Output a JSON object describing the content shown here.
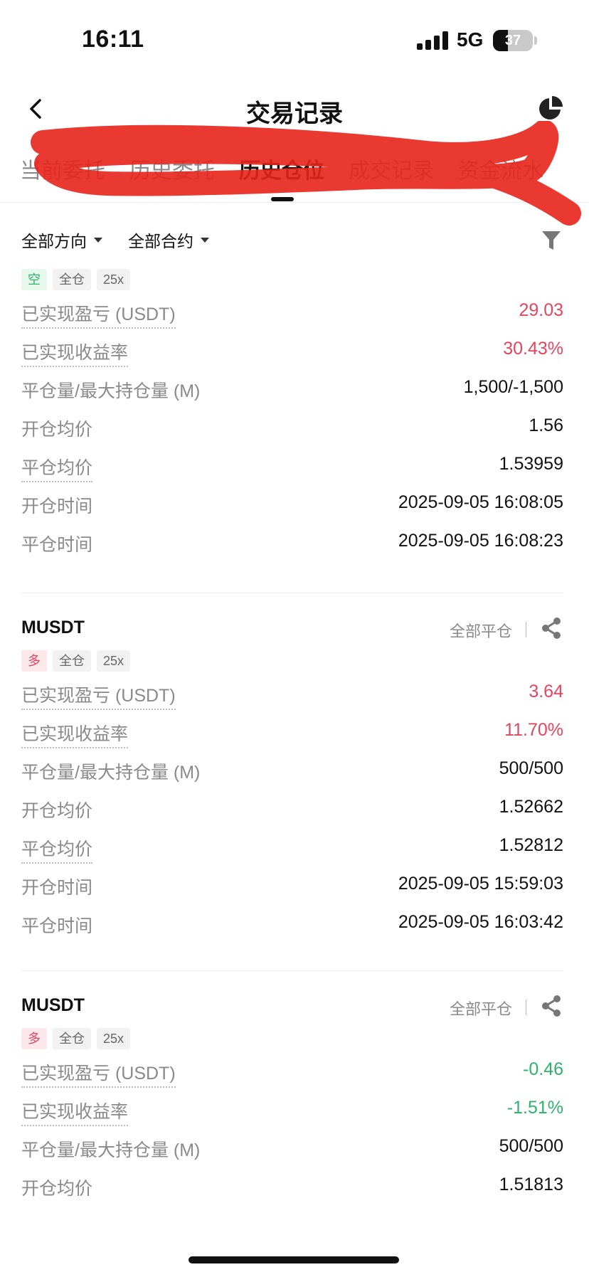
{
  "status": {
    "time": "16:11",
    "network": "5G",
    "battery": "37",
    "battery_level": 0.37
  },
  "header": {
    "title": "交易记录",
    "back_icon": "chevron-left-icon",
    "right_icon": "pie-chart-icon"
  },
  "tabs": [
    {
      "label": "当前委托",
      "active": false
    },
    {
      "label": "历史委托",
      "active": false
    },
    {
      "label": "历史仓位",
      "active": true
    },
    {
      "label": "成交记录",
      "active": false
    },
    {
      "label": "资金流水",
      "active": false
    }
  ],
  "filters": {
    "direction": "全部方向",
    "contract": "全部合约",
    "filter_icon": "funnel-icon"
  },
  "colors": {
    "profit": "#e5455d",
    "loss": "#2eb36b",
    "scribble": "#e8231b"
  },
  "close_all_label": "全部平仓",
  "cards": [
    {
      "symbol": "",
      "tags": [
        "空",
        "全仓",
        "25x"
      ],
      "rows": [
        {
          "label": "已实现盈亏 (USDT)",
          "value": "29.03"
        },
        {
          "label": "已实现收益率",
          "value": "30.43%"
        },
        {
          "label": "平仓量/最大持仓量 (M)",
          "value": "1,500/-1,500"
        },
        {
          "label": "开仓均价",
          "value": "1.56"
        },
        {
          "label": "平仓均价",
          "value": "1.53959"
        },
        {
          "label": "开仓时间",
          "value": "2025-09-05 16:08:05"
        },
        {
          "label": "平仓时间",
          "value": "2025-09-05 16:08:23"
        }
      ]
    },
    {
      "symbol": "MUSDT",
      "tags": [
        "多",
        "全仓",
        "25x"
      ],
      "rows": [
        {
          "label": "已实现盈亏 (USDT)",
          "value": "3.64"
        },
        {
          "label": "已实现收益率",
          "value": "11.70%"
        },
        {
          "label": "平仓量/最大持仓量 (M)",
          "value": "500/500"
        },
        {
          "label": "开仓均价",
          "value": "1.52662"
        },
        {
          "label": "平仓均价",
          "value": "1.52812"
        },
        {
          "label": "开仓时间",
          "value": "2025-09-05 15:59:03"
        },
        {
          "label": "平仓时间",
          "value": "2025-09-05 16:03:42"
        }
      ]
    },
    {
      "symbol": "MUSDT",
      "tags": [
        "多",
        "全仓",
        "25x"
      ],
      "rows": [
        {
          "label": "已实现盈亏 (USDT)",
          "value": "-0.46"
        },
        {
          "label": "已实现收益率",
          "value": "-1.51%"
        },
        {
          "label": "平仓量/最大持仓量 (M)",
          "value": "500/500"
        },
        {
          "label": "开仓均价",
          "value": "1.51813"
        }
      ]
    }
  ]
}
